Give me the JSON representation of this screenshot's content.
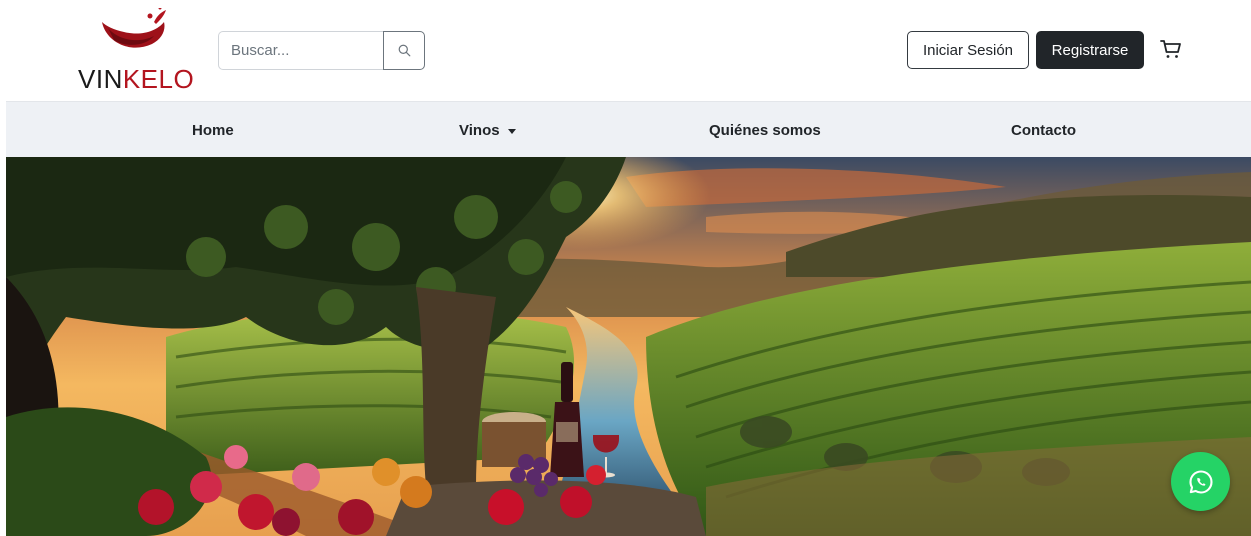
{
  "header": {
    "logo": {
      "text_part1": "VIN",
      "text_part2": "KELO"
    },
    "search": {
      "placeholder": "Buscar...",
      "icon": "search-icon"
    },
    "login_label": "Iniciar Sesión",
    "register_label": "Registrarse",
    "cart_icon": "cart-icon"
  },
  "nav": {
    "items": [
      {
        "label": "Home"
      },
      {
        "label": "Vinos",
        "has_dropdown": true
      },
      {
        "label": "Quiénes somos"
      },
      {
        "label": "Contacto"
      }
    ]
  },
  "hero": {
    "image": "vineyard-sunset-with-wine-bottle-and-glass"
  },
  "floating": {
    "whatsapp_icon": "whatsapp-icon"
  },
  "colors": {
    "brand_red": "#b3151f",
    "dark": "#212529",
    "nav_bg": "#eef1f5",
    "whatsapp_green": "#25d366"
  }
}
